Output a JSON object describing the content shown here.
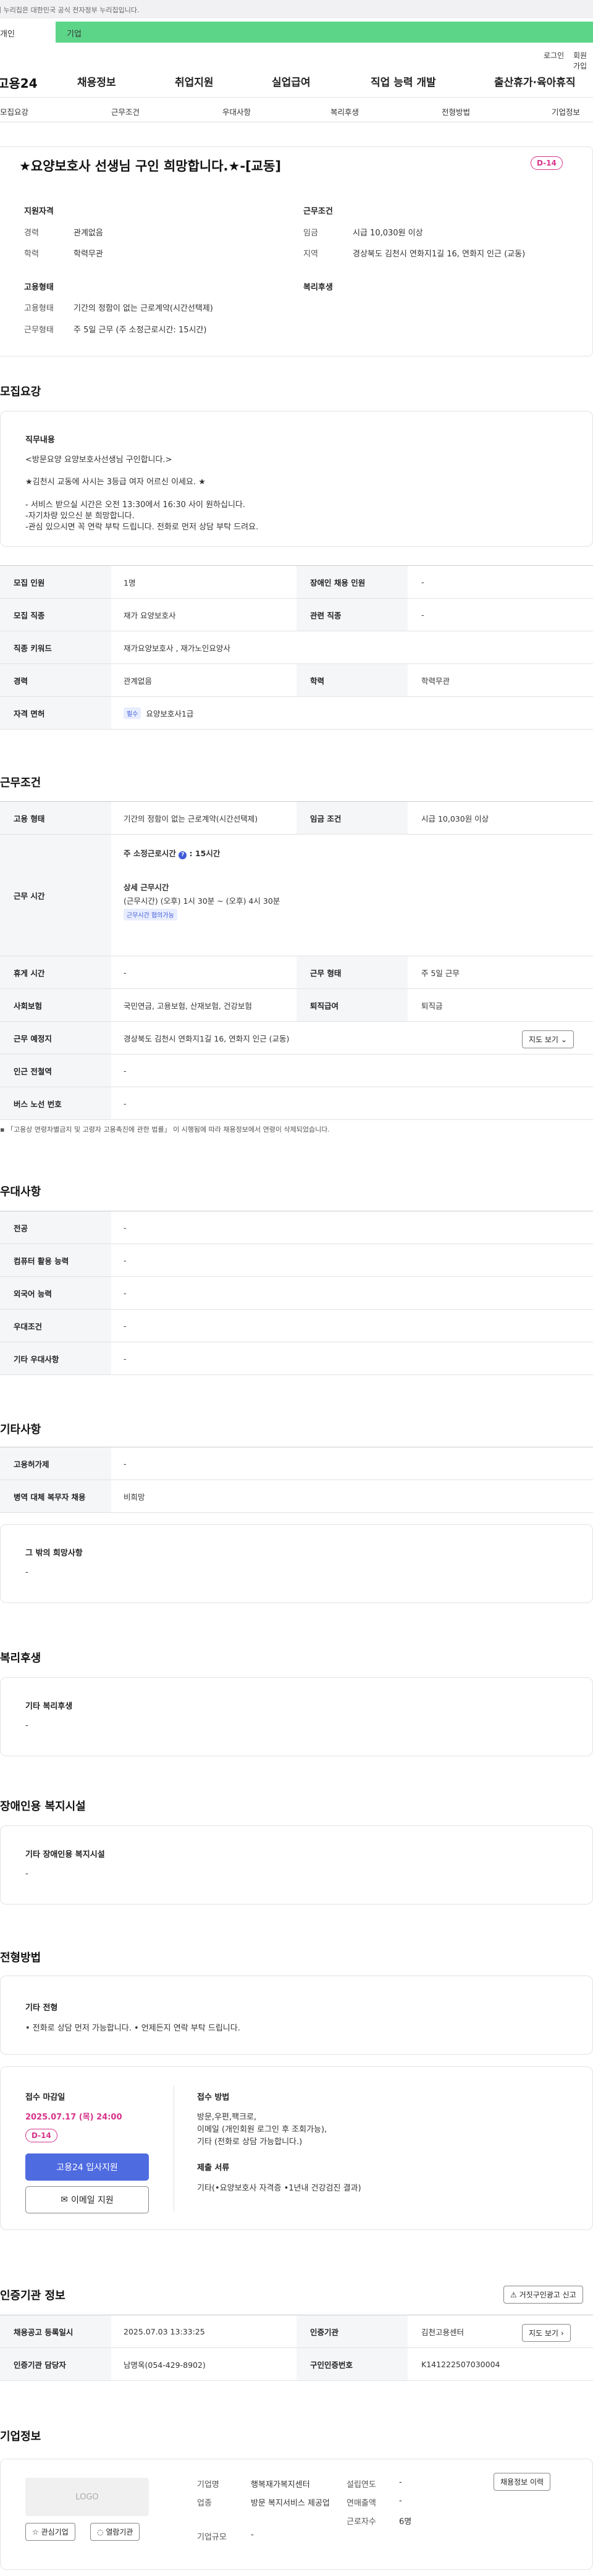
{
  "gov_banner": "이 누리집은 대한민국 공식 전자정부 누리집입니다.",
  "top_tabs": {
    "individual": "개인",
    "business": "기업"
  },
  "util": {
    "login": "로그인",
    "join": "회원가입"
  },
  "logo": "고용24",
  "gnb": [
    "채용정보",
    "취업지원",
    "실업급여",
    "직업 능력 개발",
    "출산휴가·육아휴직"
  ],
  "subnav": [
    "모집요강",
    "근무조건",
    "우대사항",
    "복리후생",
    "전형방법",
    "기업정보"
  ],
  "job": {
    "title": "★요양보호사 선생님 구인 희망합니다.★-[교동]",
    "dday": "D-14"
  },
  "summary": {
    "qual_title": "지원자격",
    "career_lbl": "경력",
    "career": "관계없음",
    "edu_lbl": "학력",
    "edu": "학력무관",
    "cond_title": "근무조건",
    "wage_lbl": "임금",
    "wage": "시급 10,030원 이상",
    "region_lbl": "지역",
    "region": "경상북도 김천시 연화지1길 16, 연화지 인근 (교동)",
    "emp_title": "고용형태",
    "emptype_lbl": "고용형태",
    "emptype": "기간의 정함이 없는 근로계약(시간선택제)",
    "workform_lbl": "근무형태",
    "workform": "주 5일 근무 (주 소정근로시간: 15시간)",
    "welfare_title": "복리후생"
  },
  "recruit": {
    "section": "모집요강",
    "duty_title": "직무내용",
    "duty_lines": [
      "<방문요양 요양보호사선생님 구인합니다.>",
      "★김천시 교동에 사시는 3등급 여자 어르신 이세요. ★",
      "- 서비스 받으실 시간은 오전 13:30에서 16:30 사이 원하십니다.",
      "-자기차량 있으신 분 희망합니다.",
      "-관심 있으시면 꼭 연락 부탁 드립니다. 전화로 먼저 상담 부탁 드려요."
    ],
    "rows": [
      {
        "l": "모집 인원",
        "v": "1명",
        "l2": "장애인 채용 인원",
        "v2": "-"
      },
      {
        "l": "모집 직종",
        "v": "재가 요양보호사",
        "l2": "관련 직종",
        "v2": "-"
      },
      {
        "l": "직종 키워드",
        "v": "재가요양보호사 , 재가노인요양사"
      },
      {
        "l": "경력",
        "v": "관계없음",
        "l2": "학력",
        "v2": "학력무관"
      },
      {
        "l": "자격 면허",
        "tag": "필수",
        "v": "요양보호사1급"
      }
    ]
  },
  "workcond": {
    "section": "근무조건",
    "emp_l": "고용 형태",
    "emp_v": "기간의 정함이 없는 근로계약(시간선택제)",
    "wage_l": "임금 조건",
    "wage_v": "시급 10,030원 이상",
    "time_l": "근무 시간",
    "time_week": "주 소정근로시간",
    "time_hours": ": 15시간",
    "detail_title": "상세 근무시간",
    "detail_line": "(근무시간) (오후) 1시 30분 ~ (오후) 4시 30분",
    "detail_tag": "근무시간 협의가능",
    "rest_l": "휴게 시간",
    "rest_v": "-",
    "form_l": "근무 형태",
    "form_v": "주 5일 근무",
    "ins_l": "사회보험",
    "ins_v": "국민연금, 고용보험, 산재보험, 건강보험",
    "ret_l": "퇴직급여",
    "ret_v": "퇴직금",
    "place_l": "근무 예정지",
    "place_v": "경상북도 김천시 연화지1길 16, 연화지 인근 (교동)",
    "map_btn": "지도 보기",
    "subway_l": "인근 전철역",
    "subway_v": "-",
    "bus_l": "버스 노선 번호",
    "bus_v": "-",
    "note": "「고용상 연령차별금지 및 고령자 고용촉진에 관한 법률」 이 시행됨에 따라 채용정보에서 연령이 삭제되었습니다."
  },
  "pref": {
    "section": "우대사항",
    "rows": [
      {
        "l": "전공",
        "v": "-"
      },
      {
        "l": "컴퓨터 활용 능력",
        "v": "-"
      },
      {
        "l": "외국어 능력",
        "v": "-"
      },
      {
        "l": "우대조건",
        "v": "-"
      },
      {
        "l": "기타 우대사항",
        "v": "-"
      }
    ]
  },
  "etc": {
    "section": "기타사항",
    "rows": [
      {
        "l": "고용허가제",
        "v": "-"
      },
      {
        "l": "병역 대체 복무자 채용",
        "v": "비희망"
      }
    ],
    "other_title": "그 밖의 희망사항",
    "other_v": "-"
  },
  "welfare": {
    "section": "복리후생",
    "title": "기타 복리후생",
    "v": "-"
  },
  "disabled": {
    "section": "장애인용 복지시설",
    "title": "기타 장애인용 복지시설",
    "v": "-"
  },
  "screening": {
    "section": "전형방법",
    "title": "기타 전형",
    "v": "• 전화로 상담 먼저 가능합니다. • 언제든지 연락 부탁 드립니다."
  },
  "apply": {
    "deadline_title": "접수 마감일",
    "deadline": "2025.07.17 (목) 24:00",
    "dday": "D-14",
    "online_btn": "고용24 입사지원",
    "email_btn": "이메일 지원",
    "method_title": "접수 방법",
    "method_lines": [
      "방문,우편,팩크로,",
      "이메일 (개인회원 로그인 후 조회가능),",
      "기타 (전화로 상담 가능합니다.)"
    ],
    "docs_title": "제출 서류",
    "docs": "기타(•요양보호사 자격증 •1년내 건강검진 결과)"
  },
  "cert": {
    "section": "인증기관 정보",
    "report_btn": "거짓구인광고 신고",
    "reg_l": "채용공고 등록일시",
    "reg_v": "2025.07.03 13:33:25",
    "org_l": "인증기관",
    "org_v": "김천고용센터",
    "manager_l": "인증기관 담당자",
    "manager_v": "남명옥(054-429-8902)",
    "cno_l": "구인인증번호",
    "cno_v": "K141222507030004",
    "map_btn": "지도 보기"
  },
  "company": {
    "section": "기업정보",
    "logo_placeholder": "LOGO",
    "fav_btn": "관심기업",
    "note_btn": "열람기관",
    "history_btn": "채용정보 이력",
    "fields": [
      {
        "l": "기업명",
        "v": "행복재가복지센터"
      },
      {
        "l": "업종",
        "v": "방문 복지서비스 제공업"
      },
      {
        "l": "기업규모",
        "v": "-"
      }
    ],
    "fields2": [
      {
        "l": "설립연도",
        "v": "-"
      },
      {
        "l": "연매출액",
        "v": "-"
      },
      {
        "l": "근로자수",
        "v": "6명"
      }
    ]
  }
}
